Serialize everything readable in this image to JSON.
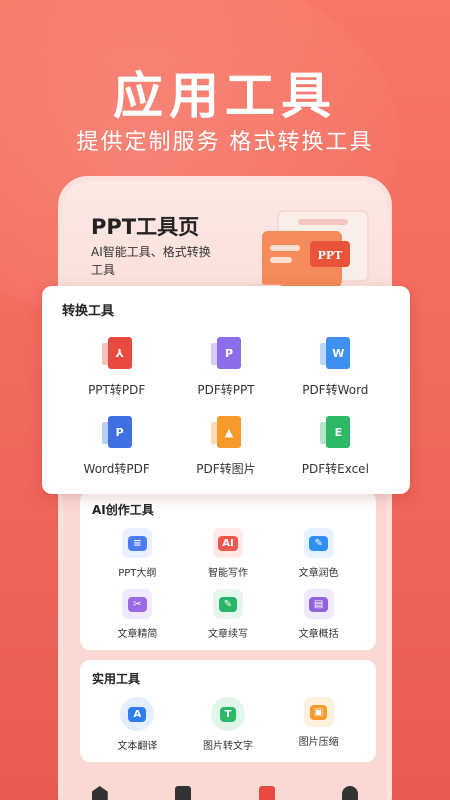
{
  "headline": "应用工具",
  "subline": "提供定制服务 格式转换工具",
  "ppt_page": {
    "title": "PPT工具页",
    "desc": "AI智能工具、格式转换工具",
    "badge": "PPT"
  },
  "convert": {
    "title": "转换工具",
    "items": [
      {
        "label": "PPT转PDF",
        "glyph": "⅄",
        "color": "#e94a3f"
      },
      {
        "label": "PDF转PPT",
        "glyph": "P",
        "color": "#8c6ce8"
      },
      {
        "label": "PDF转Word",
        "glyph": "W",
        "color": "#3d8ff0"
      },
      {
        "label": "Word转PDF",
        "glyph": "P",
        "color": "#3f6fe0"
      },
      {
        "label": "PDF转图片",
        "glyph": "▲",
        "color": "#f59a2b"
      },
      {
        "label": "PDF转Excel",
        "glyph": "E",
        "color": "#2cb865"
      }
    ]
  },
  "ai": {
    "title": "AI创作工具",
    "items": [
      {
        "label": "PPT大纲",
        "glyph": "≡",
        "color": "#4b7cf0"
      },
      {
        "label": "智能写作",
        "glyph": "AI",
        "color": "#f0564b"
      },
      {
        "label": "文章润色",
        "glyph": "✎",
        "color": "#2f8ff2"
      },
      {
        "label": "文章精简",
        "glyph": "✂",
        "color": "#9a6ae6"
      },
      {
        "label": "文章续写",
        "glyph": "✎",
        "color": "#29b567"
      },
      {
        "label": "文章概括",
        "glyph": "▤",
        "color": "#8f63de"
      }
    ]
  },
  "practical": {
    "title": "实用工具",
    "items": [
      {
        "label": "文本翻译",
        "glyph": "A",
        "color": "#2f7df0"
      },
      {
        "label": "图片转文字",
        "glyph": "T",
        "color": "#2cb865"
      },
      {
        "label": "图片压缩",
        "glyph": "▣",
        "color": "#f59a2b"
      }
    ]
  },
  "tabbar": {
    "items": [
      "home-icon",
      "document-icon",
      "toolbox-icon",
      "profile-icon"
    ],
    "active_color": "#e94a3f"
  }
}
